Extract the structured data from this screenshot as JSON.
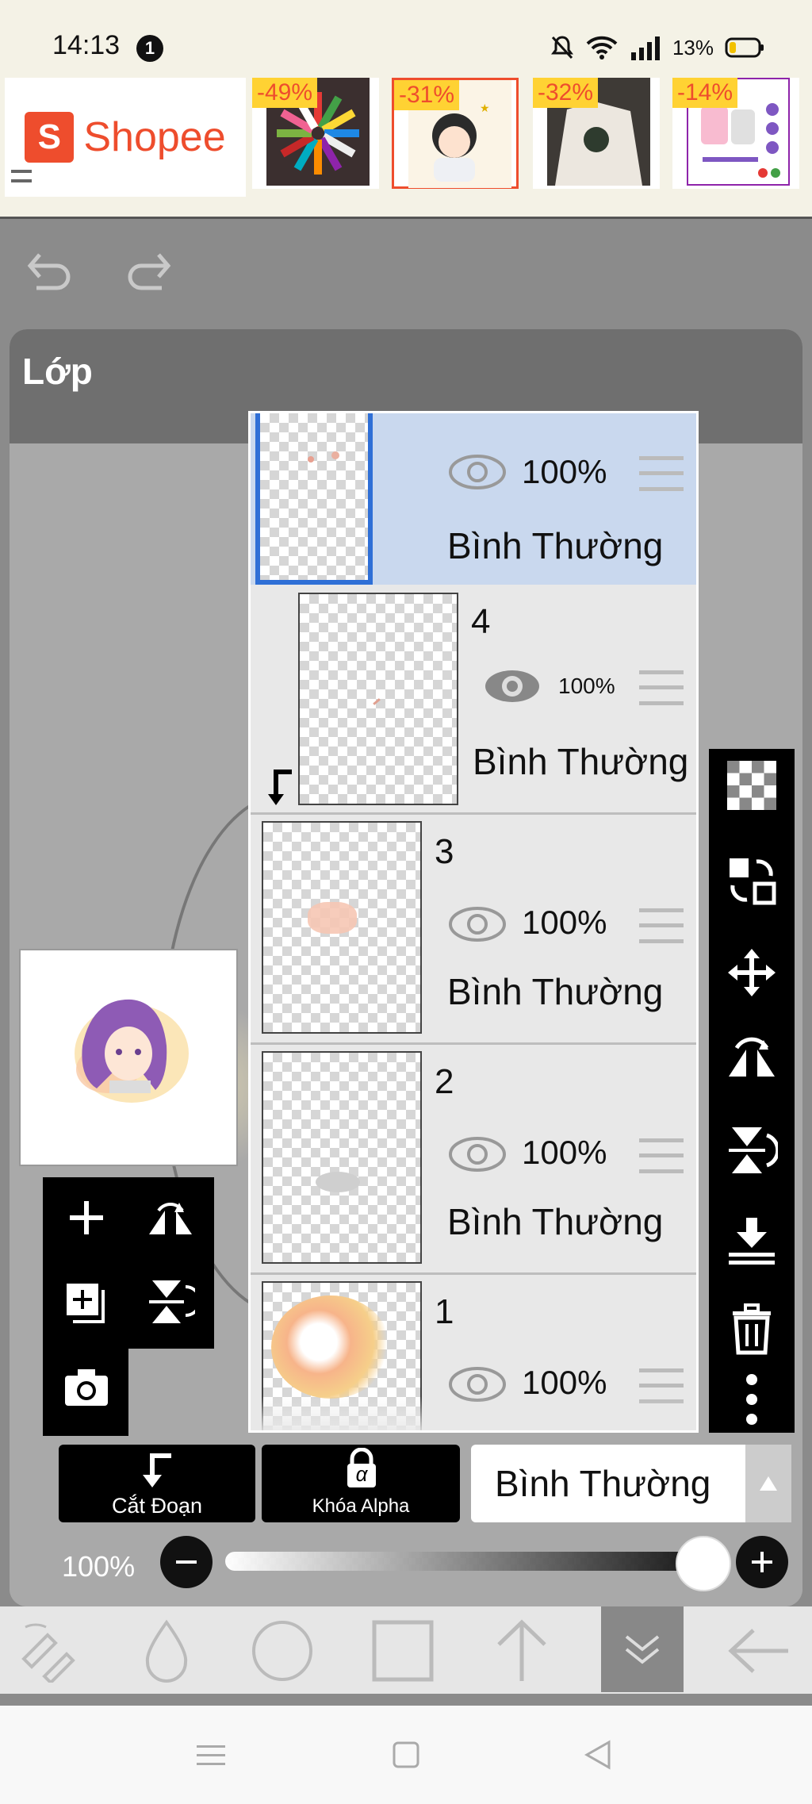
{
  "status_bar": {
    "time": "14:13",
    "notification_count": "1",
    "battery": "13%",
    "icons": [
      "bell-off-icon",
      "wifi-icon",
      "signal-icon",
      "battery-icon"
    ]
  },
  "ad": {
    "brand": "Shopee",
    "logo_letter": "S",
    "brand_color": "#ee4d2d",
    "products": [
      {
        "discount": "-49%"
      },
      {
        "discount": "-31%"
      },
      {
        "discount": "-32%"
      },
      {
        "discount": "-14%"
      }
    ]
  },
  "panel": {
    "title": "Lớp"
  },
  "layers": [
    {
      "number": "",
      "opacity": "100%",
      "mode": "Bình Thường",
      "selected": true
    },
    {
      "number": "4",
      "opacity": "100%",
      "mode": "Bình Thường",
      "clipped": true
    },
    {
      "number": "3",
      "opacity": "100%",
      "mode": "Bình Thường"
    },
    {
      "number": "2",
      "opacity": "100%",
      "mode": "Bình Thường"
    },
    {
      "number": "1",
      "opacity": "100%",
      "mode": "Bình Thường"
    }
  ],
  "right_tools": [
    "transparent-layer-icon",
    "swap-layer-icon",
    "move-icon",
    "flip-horizontal-icon",
    "flip-vertical-icon",
    "merge-down-icon",
    "trash-icon",
    "more-vertical-icon"
  ],
  "left_tools": [
    "add-layer-icon",
    "flip-canvas-horizontal-icon",
    "duplicate-layer-icon",
    "flip-canvas-vertical-icon",
    "camera-icon"
  ],
  "controls": {
    "clip_label": "Cắt Đoạn",
    "alpha_lock_label": "Khóa Alpha",
    "alpha_symbol": "α",
    "blend_mode": "Bình Thường",
    "opacity_label": "100%",
    "opacity_value": 1.0
  },
  "colors": {
    "selection_blue": "#2f6fd6",
    "selected_row": "#c9d8ee",
    "accent_orange": "#ee4d2d"
  }
}
